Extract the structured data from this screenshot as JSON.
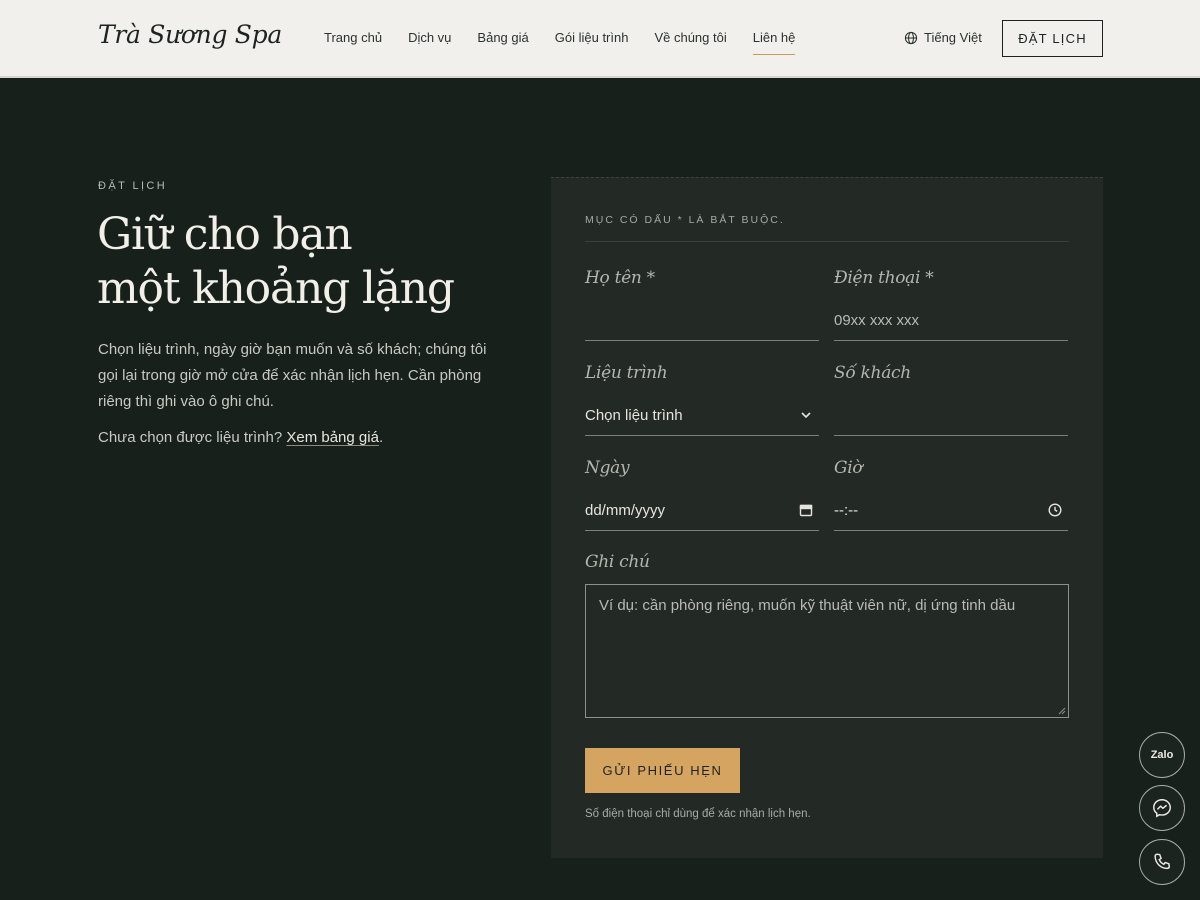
{
  "header": {
    "logo": "Trà Sương Spa",
    "nav": [
      "Trang chủ",
      "Dịch vụ",
      "Bảng giá",
      "Gói liệu trình",
      "Về chúng tôi",
      "Liên hệ"
    ],
    "active_nav": "Liên hệ",
    "language": "Tiếng Việt",
    "book_button": "ĐẶT LỊCH"
  },
  "intro": {
    "eyebrow": "ĐẶT LỊCH",
    "headline_line1": "Giữ cho bạn",
    "headline_line2": "một khoảng lặng",
    "body": "Chọn liệu trình, ngày giờ bạn muốn và số khách; chúng tôi gọi lại trong giờ mở cửa để xác nhận lịch hẹn. Cần phòng riêng thì ghi vào ô ghi chú.",
    "pricing_prompt": "Chưa chọn được liệu trình?",
    "pricing_link": "Xem bảng giá",
    "pricing_suffix": "."
  },
  "form": {
    "required_note": "MỤC CÓ DẤU * LÀ BẮT BUỘC.",
    "name_label": "Họ tên *",
    "name_value": "",
    "phone_label": "Điện thoại *",
    "phone_placeholder": "09xx xxx xxx",
    "plan_label": "Liệu trình",
    "plan_selected": "Chọn liệu trình",
    "guests_label": "Số khách",
    "guests_value": "",
    "date_label": "Ngày",
    "date_placeholder": "dd/mm/yyyy",
    "time_label": "Giờ",
    "time_placeholder": "--:--",
    "notes_label": "Ghi chú",
    "notes_placeholder": "Ví dụ: cần phòng riêng, muốn kỹ thuật viên nữ, dị ứng tinh dầu",
    "submit_label": "GỬI PHIẾU HẸN",
    "privacy_note": "Số điện thoại chỉ dùng để xác nhận lịch hẹn."
  },
  "floating": {
    "zalo_label": "Zalo",
    "messenger_icon": "messenger-icon",
    "phone_icon": "phone-icon"
  },
  "colors": {
    "background": "#18201c",
    "card": "#232a26",
    "header": "#f1f0ec",
    "accent": "#d6a461"
  }
}
